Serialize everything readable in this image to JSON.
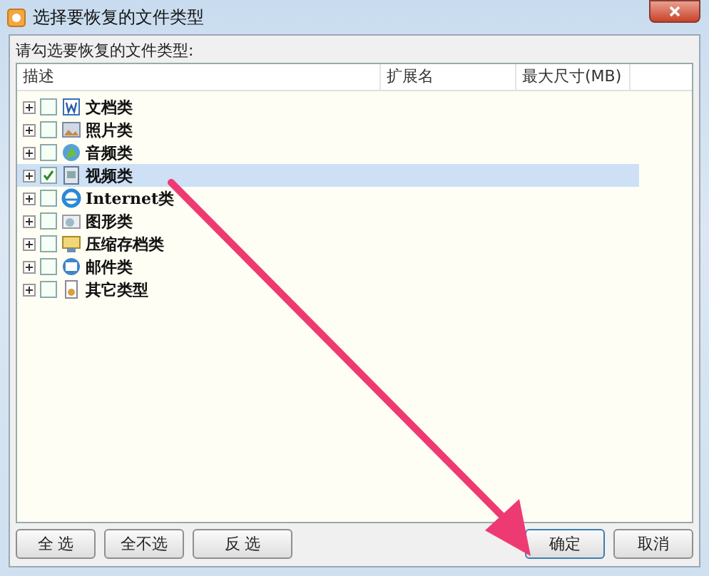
{
  "window": {
    "title": "选择要恢复的文件类型"
  },
  "prompt": "请勾选要恢复的文件类型:",
  "table": {
    "columns": [
      "描述",
      "扩展名",
      "最大尺寸(MB)"
    ],
    "rows": [
      {
        "label": "文档类",
        "checked": false,
        "selected": false
      },
      {
        "label": "照片类",
        "checked": false,
        "selected": false
      },
      {
        "label": "音频类",
        "checked": false,
        "selected": false
      },
      {
        "label": "视频类",
        "checked": true,
        "selected": true
      },
      {
        "label": "Internet类",
        "checked": false,
        "selected": false
      },
      {
        "label": "图形类",
        "checked": false,
        "selected": false
      },
      {
        "label": "压缩存档类",
        "checked": false,
        "selected": false
      },
      {
        "label": "邮件类",
        "checked": false,
        "selected": false
      },
      {
        "label": "其它类型",
        "checked": false,
        "selected": false
      }
    ]
  },
  "buttons_left": [
    "全 选",
    "全不选",
    "反 选"
  ],
  "buttons_right": [
    "确定",
    "取消"
  ]
}
